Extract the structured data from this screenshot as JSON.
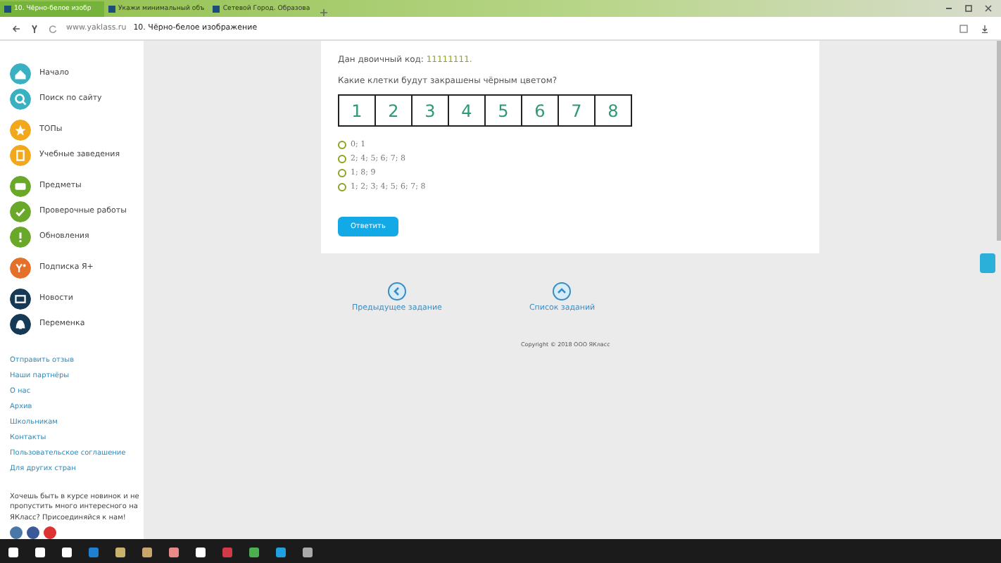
{
  "browser": {
    "tabs": [
      {
        "label": "10. Чёрно-белое изобр",
        "selected": true
      },
      {
        "label": "Укажи минимальный объ",
        "selected": false
      },
      {
        "label": "Сетевой Город. Образова",
        "selected": false
      }
    ],
    "address": {
      "domain": "www.yaklass.ru",
      "title": "10. Чёрно-белое изображение"
    }
  },
  "sidebar": {
    "items": [
      {
        "label": "Начало",
        "color": "#3ab0c3",
        "kind": "home"
      },
      {
        "label": "Поиск по сайту",
        "color": "#3ab0c3",
        "kind": "search"
      },
      {
        "label": "ТОПы",
        "color": "#f2a81d",
        "kind": "star"
      },
      {
        "label": "Учебные заведения",
        "color": "#f2a81d",
        "kind": "school"
      },
      {
        "label": "Предметы",
        "color": "#6aa82a",
        "kind": "book"
      },
      {
        "label": "Проверочные работы",
        "color": "#6aa82a",
        "kind": "check"
      },
      {
        "label": "Обновления",
        "color": "#6aa82a",
        "kind": "alert"
      },
      {
        "label": "Подписка Я+",
        "color": "#e5702a",
        "kind": "plus"
      },
      {
        "label": "Новости",
        "color": "#163a55",
        "kind": "news"
      },
      {
        "label": "Переменка",
        "color": "#163a55",
        "kind": "bell"
      }
    ],
    "links": [
      "Отправить отзыв",
      "Наши партнёры",
      "О нас",
      "Архив",
      "Школьникам",
      "Контакты",
      "Пользовательское соглашение",
      "Для других стран"
    ],
    "social_text": "Хочешь быть в курсе новинок и не пропустить много интересного на ЯКласс? Присоединяйся к нам!"
  },
  "task": {
    "code_label": "Дан двоичный код: ",
    "code": "11111111.",
    "question": "Какие клетки будут закрашены чёрным цветом?",
    "cells": [
      "1",
      "2",
      "3",
      "4",
      "5",
      "6",
      "7",
      "8"
    ],
    "options": [
      {
        "label": "0; 1",
        "selected": false
      },
      {
        "label": "2; 4; 5; 6; 7; 8",
        "selected": false
      },
      {
        "label": "1; 8; 9",
        "selected": false
      },
      {
        "label": "1; 2; 3; 4; 5; 6; 7; 8",
        "selected": false
      }
    ],
    "submit": "Ответить"
  },
  "navigation": [
    {
      "label": "Предыдущее задание",
      "kind": "prev"
    },
    {
      "label": "Список заданий",
      "kind": "up"
    }
  ],
  "copyright": "Copyright © 2018 ООО ЯКласс"
}
